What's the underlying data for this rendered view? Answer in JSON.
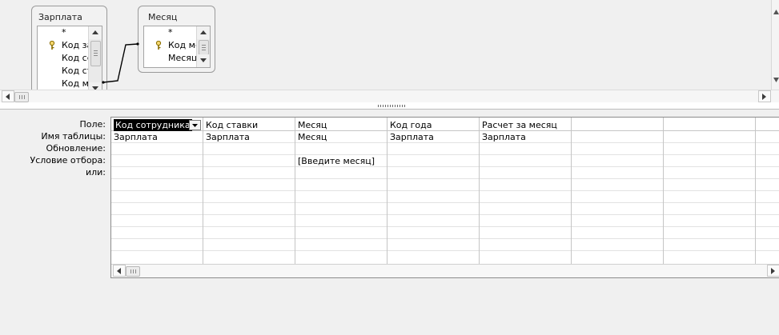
{
  "tables": [
    {
      "title": "Зарплата",
      "fields": [
        "*",
        "Код за",
        "Код сс",
        "Код ст",
        "Код ме"
      ],
      "key_field_index": 1
    },
    {
      "title": "Месяц",
      "fields": [
        "*",
        "Код ме",
        "Месяц"
      ],
      "key_field_index": 1
    }
  ],
  "grid": {
    "row_labels": [
      "Поле:",
      "Имя таблицы:",
      "Обновление:",
      "Условие отбора:",
      "или:"
    ],
    "columns": [
      {
        "field": "Код сотрудника",
        "table": "Зарплата",
        "criteria": ""
      },
      {
        "field": "Код ставки",
        "table": "Зарплата",
        "criteria": ""
      },
      {
        "field": "Месяц",
        "table": "Месяц",
        "criteria": "[Введите месяц]"
      },
      {
        "field": "Код года",
        "table": "Зарплата",
        "criteria": ""
      },
      {
        "field": "Расчет за месяц",
        "table": "Зарплата",
        "criteria": ""
      },
      {
        "field": "",
        "table": "",
        "criteria": ""
      },
      {
        "field": "",
        "table": "",
        "criteria": ""
      }
    ]
  }
}
